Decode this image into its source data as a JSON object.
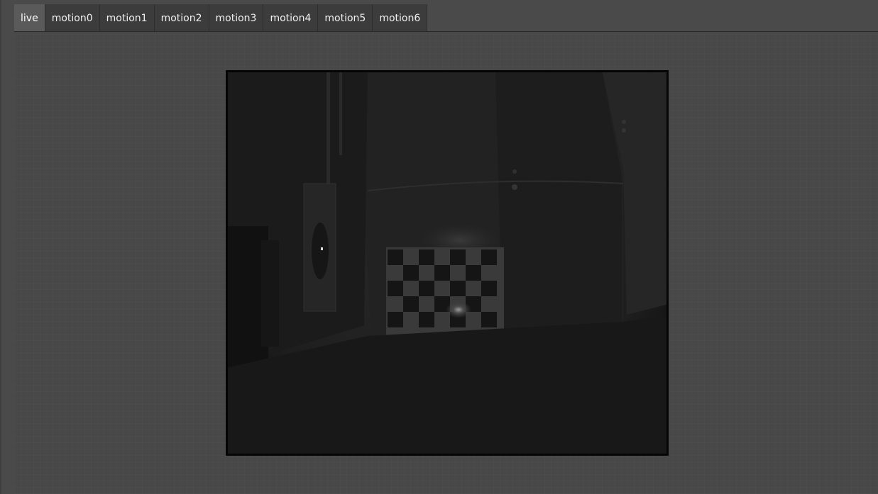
{
  "tabs": [
    {
      "label": "live",
      "active": true
    },
    {
      "label": "motion0",
      "active": false
    },
    {
      "label": "motion1",
      "active": false
    },
    {
      "label": "motion2",
      "active": false
    },
    {
      "label": "motion3",
      "active": false
    },
    {
      "label": "motion4",
      "active": false
    },
    {
      "label": "motion5",
      "active": false
    },
    {
      "label": "motion6",
      "active": false
    }
  ],
  "colors": {
    "background": "#4a4a4a",
    "tab_active": "#5a5a5a",
    "tab_inactive": "#3c3c3c",
    "text": "#f0f0f0"
  },
  "feed": {
    "kind": "grayscale-camera-image",
    "scene": "dim room with fire extinguisher, door and checkerboard calibration target"
  }
}
